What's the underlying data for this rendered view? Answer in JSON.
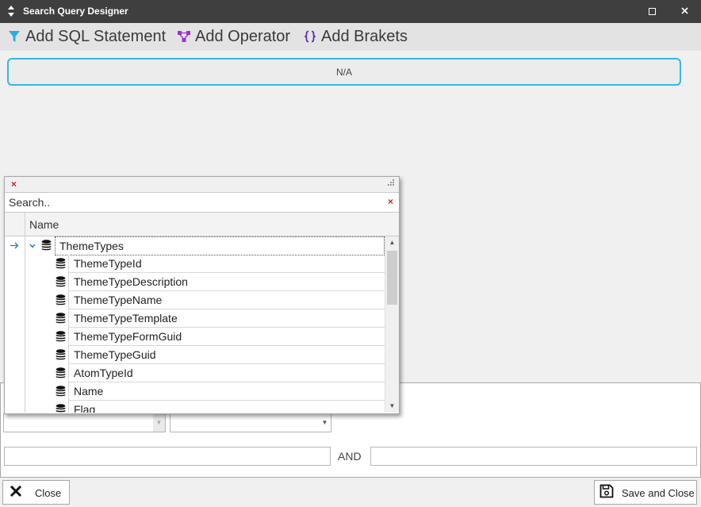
{
  "window": {
    "title": "Search Query Designer"
  },
  "toolbar": {
    "add_sql_label": "Add SQL Statement",
    "add_operator_label": "Add Operator",
    "add_brackets_label": "Add Brakets"
  },
  "query": {
    "text": "N/A"
  },
  "popup": {
    "search_placeholder": "Search..",
    "column_header": "Name",
    "tree": {
      "root": "ThemeTypes",
      "children": [
        "ThemeTypeId",
        "ThemeTypeDescription",
        "ThemeTypeName",
        "ThemeTypeTemplate",
        "ThemeTypeFormGuid",
        "ThemeTypeGuid",
        "AtomTypeId",
        "Name",
        "Flag"
      ]
    }
  },
  "condition": {
    "and_label": "AND"
  },
  "footer": {
    "close_label": "Close",
    "save_close_label": "Save and Close"
  },
  "colors": {
    "titlebar": "#3f3f3f",
    "accent": "#33b9e8",
    "operator_icon": "#a22fd6",
    "brackets_icon": "#5b2fa8"
  }
}
